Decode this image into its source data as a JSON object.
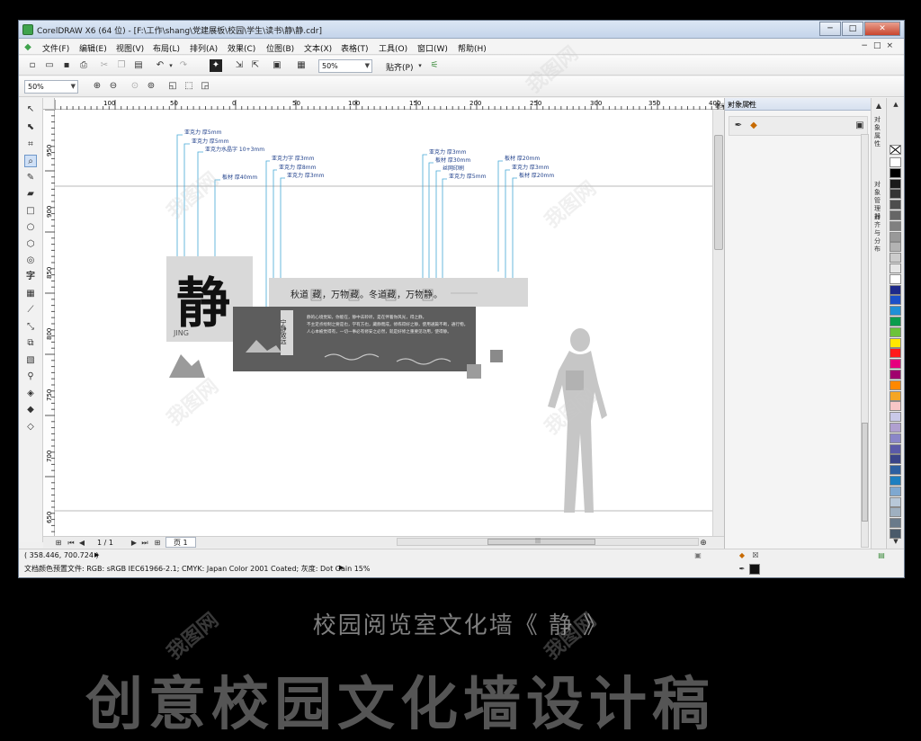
{
  "window": {
    "title": "CorelDRAW X6 (64 位) - [F:\\工作\\shang\\党建展板\\校园\\学生\\读书\\静\\静.cdr]",
    "controls": [
      "─",
      "□",
      "✕"
    ]
  },
  "menu": [
    "文件(F)",
    "编辑(E)",
    "视图(V)",
    "布局(L)",
    "排列(A)",
    "效果(C)",
    "位图(B)",
    "文本(X)",
    "表格(T)",
    "工具(O)",
    "窗口(W)",
    "帮助(H)"
  ],
  "toolbar": {
    "zoom_value": "50%",
    "snap_label": "贴齐(P)"
  },
  "propbar": {
    "zoom_value": "50%"
  },
  "rulers": {
    "h_ticks": [
      "100",
      "50",
      "0",
      "50",
      "100",
      "150",
      "200",
      "250",
      "300",
      "350",
      "400"
    ],
    "h_unit": "毫米",
    "v_ticks": [
      "950",
      "900",
      "850",
      "800",
      "750",
      "700",
      "650"
    ]
  },
  "design": {
    "callouts_left": [
      "亚克力 厚5mm",
      "亚克力 厚5mm",
      "亚克力水晶字 10+3mm",
      "板材 厚40mm",
      "亚克力字 厚3mm",
      "亚克力 厚8mm",
      "亚克力 厚3mm"
    ],
    "callouts_right": [
      "亚克力 厚3mm",
      "板材 厚30mm",
      "丝网印刷",
      "亚克力 厚5mm",
      "板材 厚20mm",
      "亚克力 厚3mm",
      "板材 厚20mm"
    ],
    "main_char": "静",
    "comma": ",",
    "pinyin": "JING",
    "vertical_seal": "宁静致远",
    "slogan": [
      "秋道",
      "藏",
      "，万物",
      "藏",
      "。冬道",
      "藏",
      "，万物",
      "静",
      "。"
    ],
    "body_lines": [
      "静的心境觉知，你能在，静中去聆听，是在伴着你风光，得之静。",
      "不主定点绘制之要是也，学有方也，藏静而成，修练得好之静，使用通篇不断，通行物。",
      "人心本被觉得有，一切一事必有修安之必然，就是好修之重要见功用，使得静。"
    ]
  },
  "docker": {
    "title": "对象属性",
    "tab_labels": [
      "对象属性",
      "对象管理器",
      "对齐与分布"
    ]
  },
  "pagebar": {
    "page_count": "1 / 1",
    "page_tab": "页 1",
    "scroll_mark": "|||"
  },
  "status": {
    "coords": "( 358.446, 700.724 )",
    "color_profile": "文档颜色预置文件: RGB: sRGB IEC61966-2.1; CMYK: Japan Color 2001 Coated; 灰度: Dot Gain 15%"
  },
  "palette": [
    "#ffffff",
    "#000000",
    "#1a1a1a",
    "#333333",
    "#4d4d4d",
    "#666666",
    "#808080",
    "#999999",
    "#b3b3b3",
    "#cccccc",
    "#e6e6e6",
    "#ffffff",
    "#1e2a8a",
    "#1b50c8",
    "#1f8fd6",
    "#0c9c4d",
    "#6cc33a",
    "#ffe800",
    "#ff1a1a",
    "#e6007e",
    "#a0006e",
    "#ff8800",
    "#f5a623",
    "#f7c6c7",
    "#c9c9e8",
    "#b0a0d0",
    "#8a86c8",
    "#5a5aa8",
    "#3a4488",
    "#2d5fa0",
    "#1d7fc0",
    "#7fa8d0",
    "#b8c8d8",
    "#9fb0c0",
    "#6a7a8a",
    "#4a5a6a"
  ],
  "outside": {
    "title": "校园阅览室文化墙《 静 》",
    "big_text": "创意校园文化墙设计稿"
  },
  "watermark": "我图网"
}
